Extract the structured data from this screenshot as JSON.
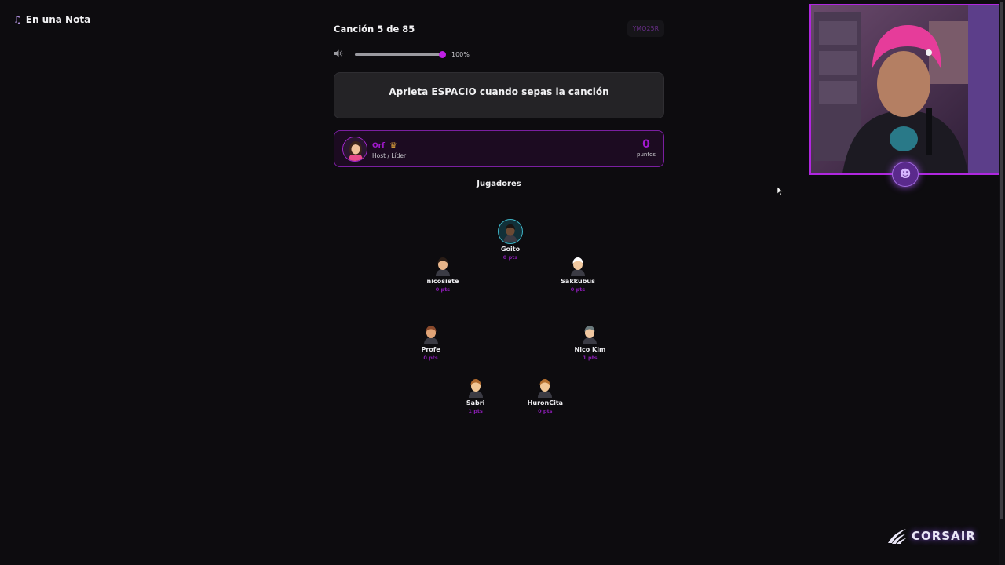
{
  "app": {
    "title": "En una Nota",
    "icon": "music-note-icon"
  },
  "game": {
    "song_progress": "Canción 5 de 85",
    "room_code": "YMQ25R",
    "volume": {
      "value": 1.0,
      "label": "100%"
    },
    "prompt": "Aprieta ESPACIO cuando sepas la canción"
  },
  "host": {
    "name": "Orf",
    "role": "Host / Líder",
    "score": "0",
    "score_label": "puntos",
    "badge_icon": "crown-icon"
  },
  "players_title": "Jugadores",
  "players": [
    {
      "name": "Goito",
      "pts": "0 pts",
      "active": true,
      "skin": "#6b4a34",
      "hair": "#1a1412"
    },
    {
      "name": "nicosiete",
      "pts": "0 pts",
      "active": false,
      "skin": "#e7b58a",
      "hair": "#2a1d16"
    },
    {
      "name": "Sakkubus",
      "pts": "0 pts",
      "active": false,
      "skin": "#f1c9a0",
      "hair": "#ffffff"
    },
    {
      "name": "Profe",
      "pts": "0 pts",
      "active": false,
      "skin": "#e0a477",
      "hair": "#8a4a2c"
    },
    {
      "name": "Nico Kim",
      "pts": "1 pts",
      "active": false,
      "skin": "#f0c7a0",
      "hair": "#6a7a7c"
    },
    {
      "name": "Sabri",
      "pts": "1 pts",
      "active": false,
      "skin": "#f2c796",
      "hair": "#b06a2e"
    },
    {
      "name": "HuronCita",
      "pts": "0 pts",
      "active": false,
      "skin": "#f2c796",
      "hair": "#b5702f"
    }
  ],
  "sponsor": {
    "name": "CORSAIR"
  },
  "colors": {
    "accent": "#a319d0",
    "background": "#0d0c0f",
    "active_ring": "#3fb6c8"
  }
}
